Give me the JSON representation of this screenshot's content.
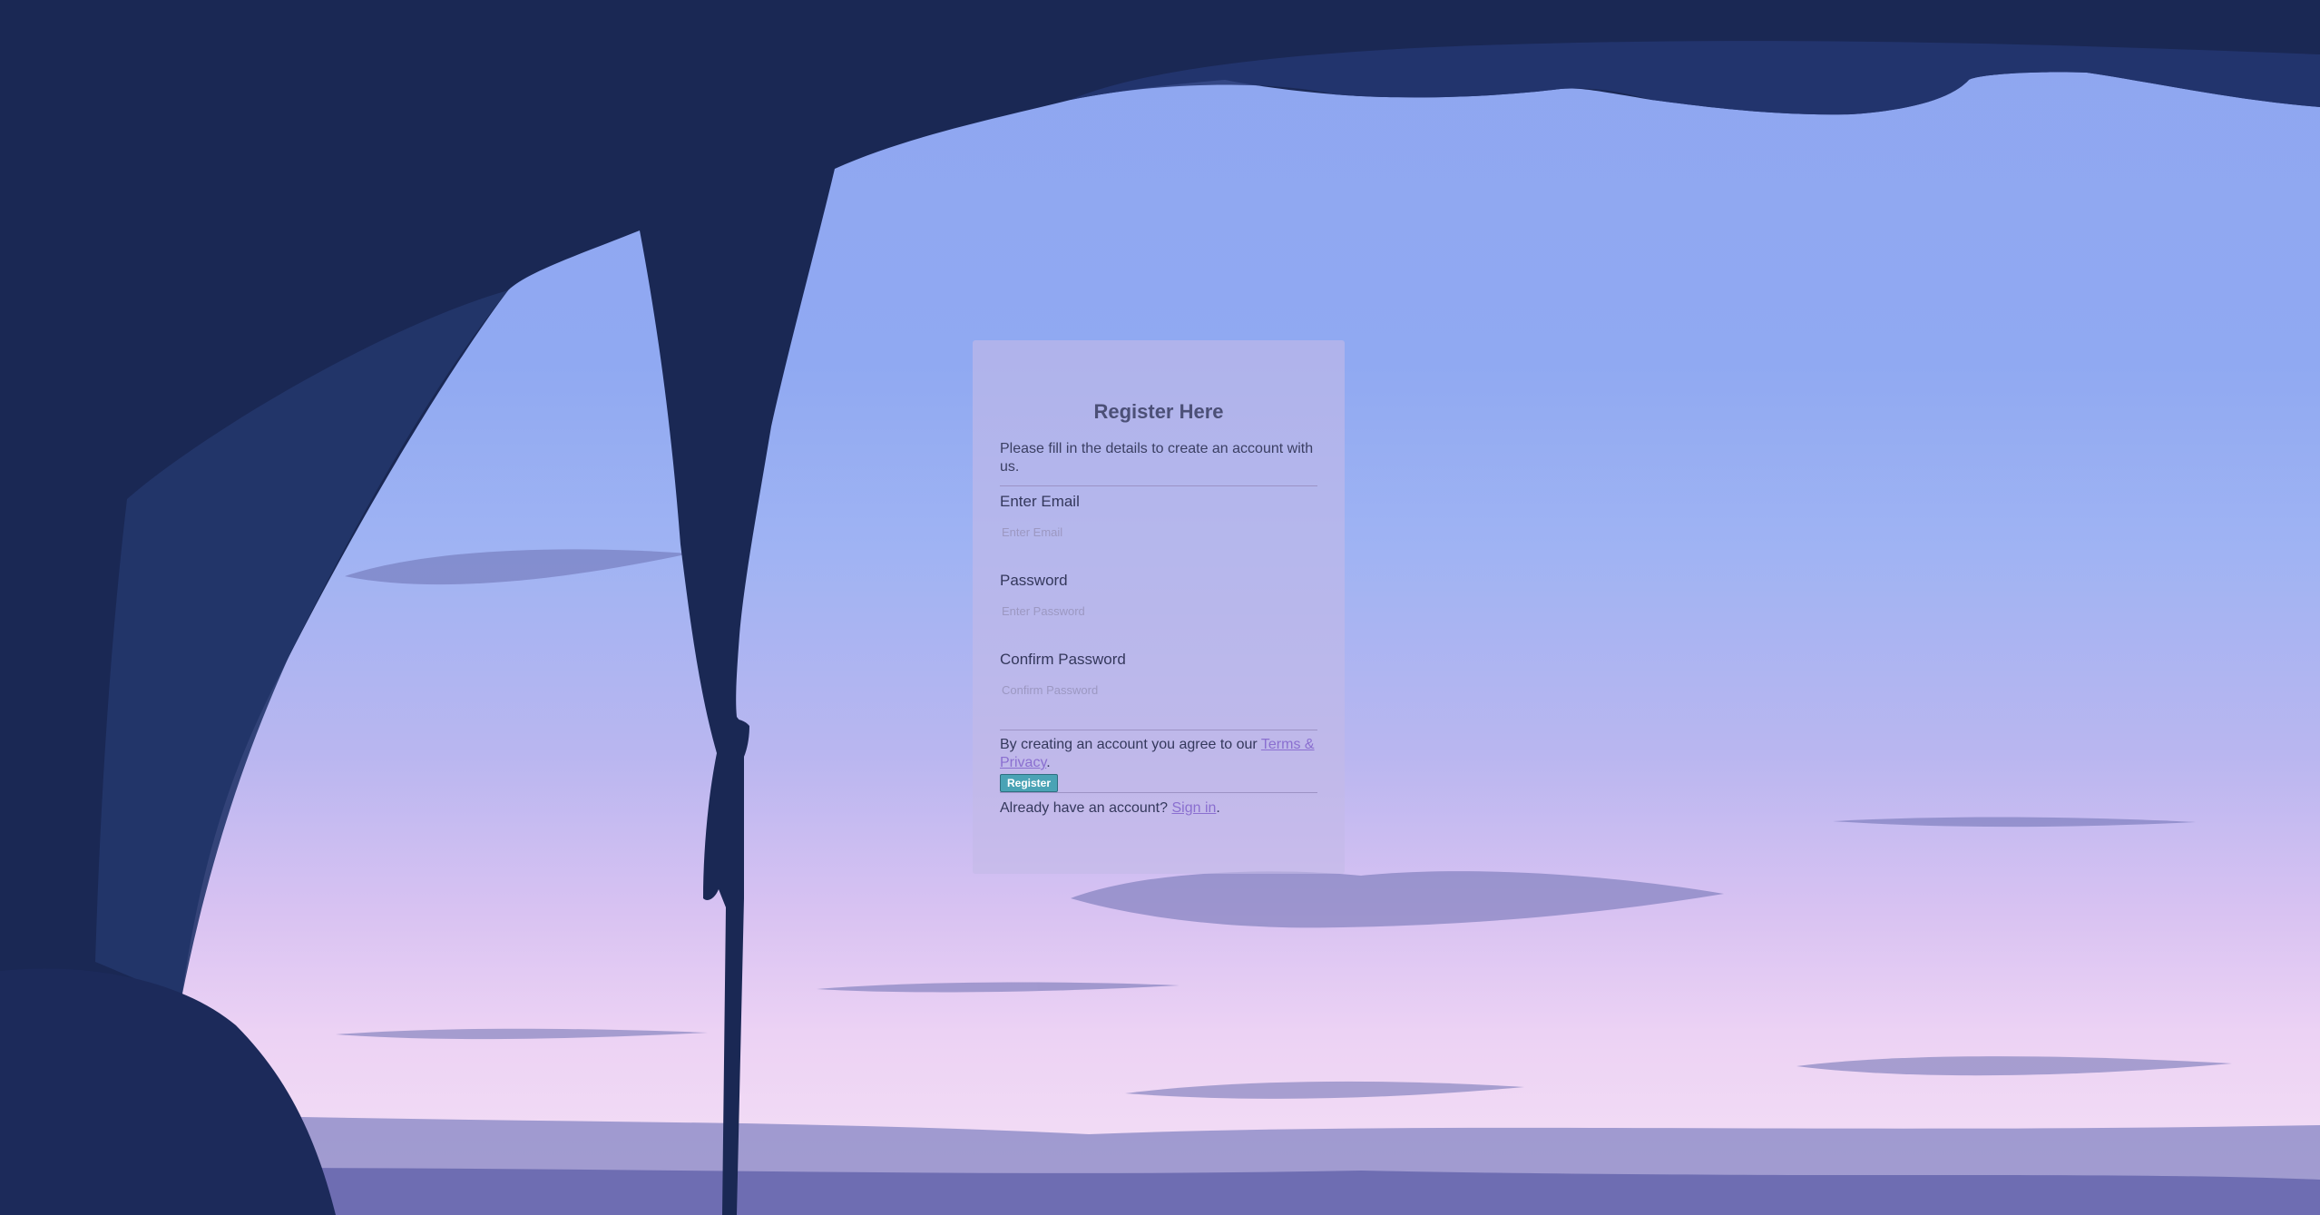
{
  "form": {
    "title": "Register Here",
    "intro": "Please fill in the details to create an account with us.",
    "email_label": "Enter Email",
    "email_placeholder": "Enter Email",
    "password_label": "Password",
    "password_placeholder": "Enter Password",
    "confirm_label": "Confirm Password",
    "confirm_placeholder": "Confirm Password",
    "terms_text": "By creating an account you agree to our",
    "terms_link": "Terms & Privacy",
    "terms_end": ".",
    "register_button": "Register",
    "signin_text": "Already have an account?",
    "signin_link": "Sign in",
    "signin_end": "."
  },
  "colors": {
    "accent_button": "#4aa3b5",
    "link": "#8a6fd0",
    "silhouette": "#1a2854"
  }
}
